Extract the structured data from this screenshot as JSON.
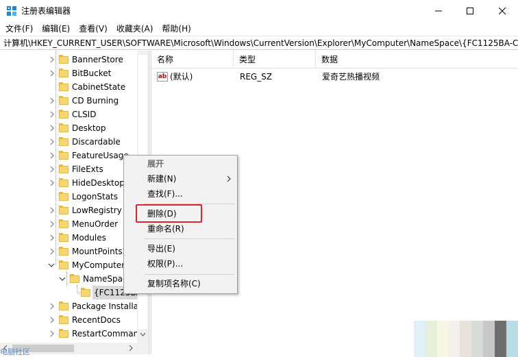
{
  "window": {
    "title": "注册表编辑器",
    "app_icon": "regedit-icon"
  },
  "menubar": {
    "items": [
      {
        "label": "文件(F)"
      },
      {
        "label": "编辑(E)"
      },
      {
        "label": "查看(V)"
      },
      {
        "label": "收藏夹(A)"
      },
      {
        "label": "帮助(H)"
      }
    ]
  },
  "address": {
    "path": "计算机\\HKEY_CURRENT_USER\\SOFTWARE\\Microsoft\\Windows\\CurrentVersion\\Explorer\\MyComputer\\NameSpace\\{FC1125BA-C5"
  },
  "tree": {
    "items": [
      {
        "label": "BannerStore",
        "expander": "collapsed"
      },
      {
        "label": "BitBucket",
        "expander": "collapsed"
      },
      {
        "label": "CabinetState",
        "expander": "none"
      },
      {
        "label": "CD Burning",
        "expander": "collapsed"
      },
      {
        "label": "CLSID",
        "expander": "collapsed"
      },
      {
        "label": "Desktop",
        "expander": "collapsed"
      },
      {
        "label": "Discardable",
        "expander": "collapsed"
      },
      {
        "label": "FeatureUsage",
        "expander": "collapsed"
      },
      {
        "label": "FileExts",
        "expander": "collapsed"
      },
      {
        "label": "HideDesktop",
        "expander": "collapsed"
      },
      {
        "label": "LogonStats",
        "expander": "none"
      },
      {
        "label": "LowRegistry",
        "expander": "collapsed"
      },
      {
        "label": "MenuOrder",
        "expander": "collapsed"
      },
      {
        "label": "Modules",
        "expander": "collapsed"
      },
      {
        "label": "MountPoints2",
        "expander": "collapsed"
      },
      {
        "label": "MyComputer",
        "expander": "expanded"
      },
      {
        "label": "NameSpac",
        "expander": "expanded"
      },
      {
        "label": "{FC1125BA",
        "expander": "none"
      },
      {
        "label": "Package Installa",
        "expander": "collapsed"
      },
      {
        "label": "RecentDocs",
        "expander": "collapsed"
      },
      {
        "label": "RestartComman",
        "expander": "collapsed"
      }
    ]
  },
  "list": {
    "columns": [
      "名称",
      "类型",
      "数据"
    ],
    "rows": [
      {
        "name": "(默认)",
        "type": "REG_SZ",
        "data": "爱奇艺热播视频",
        "icon": "ab-string-icon"
      }
    ]
  },
  "context_menu": {
    "items": [
      {
        "label": "展开"
      },
      {
        "label": "新建(N)"
      },
      {
        "label": "查找(F)..."
      },
      {
        "label": "删除(D)"
      },
      {
        "label": "重命名(R)"
      },
      {
        "label": "导出(E)"
      },
      {
        "label": "权限(P)..."
      },
      {
        "label": "复制项名称(C)"
      }
    ],
    "highlighted": "删除(D)",
    "highlight_color": "#d9252b"
  },
  "watermark": "电脑社区",
  "colors": {
    "folder": "#f7d774",
    "menu_bg": "#f2f2f2",
    "highlight_border": "#d9252b"
  }
}
